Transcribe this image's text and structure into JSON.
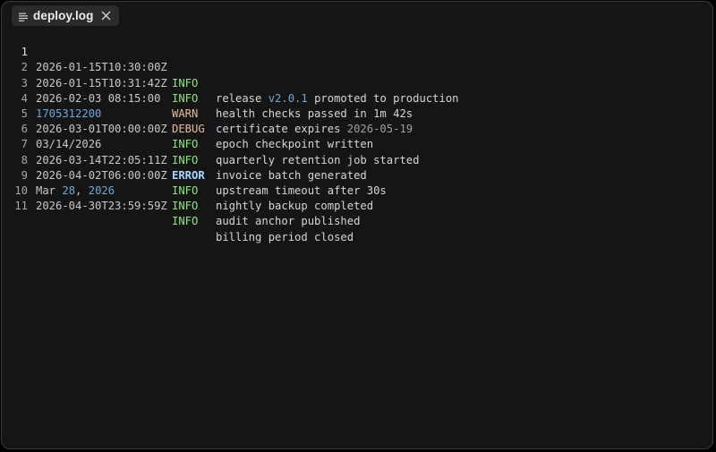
{
  "tab": {
    "filename": "deploy.log",
    "file_icon": "lines-icon",
    "close_icon": "close-icon"
  },
  "colors": {
    "info": "#8ee37f",
    "warn": "#e6b8a0",
    "debug": "#e6b8a0",
    "error": "#a8d8ff",
    "number": "#6fa7d8"
  },
  "lines": [
    {
      "n": "1",
      "ts": "2026-01-15T10:30:00Z",
      "level": "INFO",
      "msg_a": "release ",
      "msg_num": "v2.0.1",
      "msg_b": " promoted to production"
    },
    {
      "n": "2",
      "ts": "2026-01-15T10:31:42Z",
      "level": "INFO",
      "msg": "health checks passed in 1m 42s"
    },
    {
      "n": "3",
      "ts": "2026-02-03 08:15:00",
      "level": "WARN",
      "msg_a": "certificate expires ",
      "msg_dim": "2026-05-19"
    },
    {
      "n": "4",
      "ts": "1705312200",
      "level": "DEBUG",
      "msg": "epoch checkpoint written"
    },
    {
      "n": "5",
      "ts": "2026-03-01T00:00:00Z",
      "level": "INFO",
      "msg": "quarterly retention job started"
    },
    {
      "n": "6",
      "ts": "03/14/2026",
      "level": "INFO",
      "msg": "invoice batch generated"
    },
    {
      "n": "7",
      "ts": "2026-03-14T22:05:11Z",
      "level": "ERROR",
      "msg": "upstream timeout after 30s"
    },
    {
      "n": "8",
      "ts": "2026-04-02T06:00:00Z",
      "level": "INFO",
      "msg": "nightly backup completed"
    },
    {
      "n": "9",
      "ts_a": "Mar ",
      "ts_num1": "28",
      "ts_b": ", ",
      "ts_num2": "2026",
      "level": "INFO",
      "msg": "audit anchor published"
    },
    {
      "n": "10",
      "ts": "2026-04-30T23:59:59Z",
      "level": "INFO",
      "msg": "billing period closed"
    },
    {
      "n": "11"
    }
  ]
}
